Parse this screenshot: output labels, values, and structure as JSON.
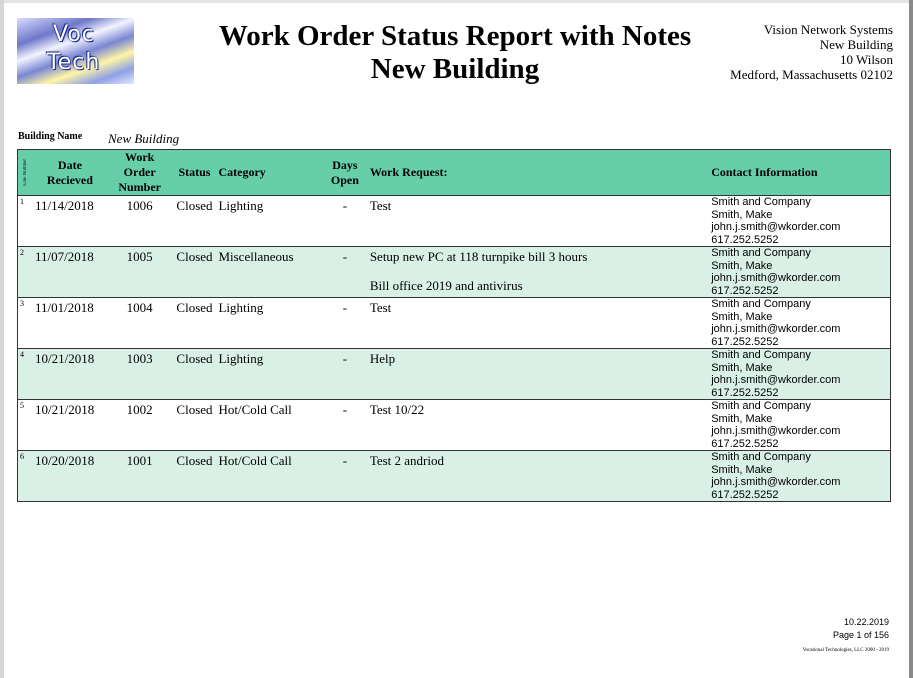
{
  "logo": {
    "line1": "Voc",
    "line2": "Tech"
  },
  "title": {
    "line1": "Work Order Status Report with Notes",
    "line2": "New Building"
  },
  "company": {
    "name": "Vision Network Systems",
    "building": "New Building",
    "street": "10 Wilson",
    "city": "Medford, Massachusetts 02102"
  },
  "building": {
    "label": "Building Name",
    "value": "New Building"
  },
  "table": {
    "headers": {
      "line_number": "Line Number",
      "date": "Date Recieved",
      "work_order": "Work Order Number",
      "status": "Status",
      "category": "Category",
      "days_open": "Days Open",
      "work_request": "Work Request:",
      "contact": "Contact Information"
    },
    "rows": [
      {
        "line": "1",
        "date": "11/14/2018",
        "wo": "1006",
        "status": "Closed",
        "category": "Lighting",
        "days": "-",
        "request": [
          "Test"
        ],
        "contact": [
          "Smith and Company",
          "Smith, Make",
          "john.j.smith@wkorder.com",
          "617.252.5252"
        ]
      },
      {
        "line": "2",
        "date": "11/07/2018",
        "wo": "1005",
        "status": "Closed",
        "category": "Miscellaneous",
        "days": "-",
        "request": [
          "Setup new PC at 118 turnpike bill 3 hours",
          "Bill office 2019 and antivirus"
        ],
        "contact": [
          "Smith and Company",
          "Smith, Make",
          "john.j.smith@wkorder.com",
          "617.252.5252"
        ]
      },
      {
        "line": "3",
        "date": "11/01/2018",
        "wo": "1004",
        "status": "Closed",
        "category": "Lighting",
        "days": "-",
        "request": [
          "Test"
        ],
        "contact": [
          "Smith and Company",
          "Smith, Make",
          "john.j.smith@wkorder.com",
          "617.252.5252"
        ]
      },
      {
        "line": "4",
        "date": "10/21/2018",
        "wo": "1003",
        "status": "Closed",
        "category": "Lighting",
        "days": "-",
        "request": [
          "Help"
        ],
        "contact": [
          "Smith and Company",
          "Smith, Make",
          "john.j.smith@wkorder.com",
          "617.252.5252"
        ]
      },
      {
        "line": "5",
        "date": "10/21/2018",
        "wo": "1002",
        "status": "Closed",
        "category": "Hot/Cold Call",
        "days": "-",
        "request": [
          "Test 10/22"
        ],
        "contact": [
          "Smith and Company",
          "Smith, Make",
          "john.j.smith@wkorder.com",
          "617.252.5252"
        ]
      },
      {
        "line": "6",
        "date": "10/20/2018",
        "wo": "1001",
        "status": "Closed",
        "category": "Hot/Cold Call",
        "days": "-",
        "request": [
          "Test 2 andriod"
        ],
        "contact": [
          "Smith and Company",
          "Smith, Make",
          "john.j.smith@wkorder.com",
          "617.252.5252"
        ]
      }
    ]
  },
  "footer": {
    "date": "10.22.2019",
    "page": "Page 1 of 156",
    "copyright": "Vocational Technologies, LLC 2000 - 2019"
  },
  "colors": {
    "header_bg": "#66cfaa",
    "alt_row_bg": "#d8f0e6"
  }
}
